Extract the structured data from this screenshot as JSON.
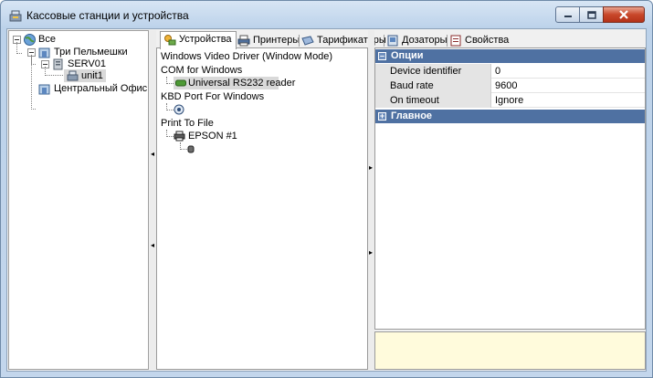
{
  "window": {
    "title": "Кассовые станции и устройства"
  },
  "left_tree": {
    "root": "Все",
    "items": [
      {
        "label": "Три Пельмешки"
      },
      {
        "label": "SERV01"
      },
      {
        "label": "unit1"
      },
      {
        "label": "Центральный Офис"
      }
    ]
  },
  "tabs": [
    {
      "label": "Устройства",
      "icon": "devices-icon",
      "active": true
    },
    {
      "label": "Принтеры",
      "icon": "printer-icon",
      "active": false
    },
    {
      "label": "Тарификаторы",
      "icon": "tariff-icon",
      "active": false
    },
    {
      "label": "Дозаторы",
      "icon": "dispenser-icon",
      "active": false
    },
    {
      "label": "Свойства",
      "icon": "properties-icon",
      "active": false
    }
  ],
  "devices": {
    "groups": [
      {
        "label": "Windows Video Driver (Window Mode)"
      },
      {
        "label": "COM for Windows",
        "child": "Universal RS232 reader"
      },
      {
        "label": "KBD Port For Windows"
      },
      {
        "label": "Print To File",
        "child": "EPSON #1"
      }
    ]
  },
  "properties": {
    "categories": [
      {
        "label": "Опции",
        "expanded": true,
        "rows": [
          {
            "name": "Device identifier",
            "value": "0"
          },
          {
            "name": "Baud rate",
            "value": "9600"
          },
          {
            "name": "On timeout",
            "value": "Ignore"
          }
        ]
      },
      {
        "label": "Главное",
        "expanded": false
      }
    ]
  },
  "colors": {
    "category_header": "#4f71a2",
    "description_panel": "#fffbdc",
    "selection": "#d9d9d9"
  }
}
